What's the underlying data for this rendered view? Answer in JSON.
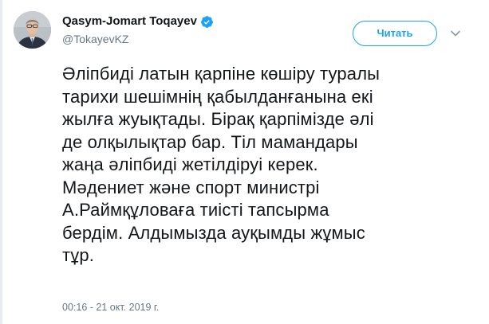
{
  "author": {
    "name": "Qasym-Jomart Toqayev",
    "handle": "@TokayevKZ",
    "verified": true
  },
  "actions": {
    "follow_label": "Читать"
  },
  "tweet": {
    "text": "Әліпбиді латын қарпіне көшіру туралы\nтарихи шешімнің қабылданғанына екі\nжылға жуықтады. Бірақ қарпімізде әлі\nде олқылықтар бар. Тіл мамандары\nжаңа әліпбиді жетілдіруі керек.\nМәдениет және спорт министрі\nА.Раймқұловаға тиісті тапсырма\nбердім. Алдымызда ауқымды жұмыс\nтұр.",
    "timestamp": "00:16 - 21 окт. 2019 г."
  },
  "colors": {
    "accent": "#1da1f2",
    "text": "#14171a",
    "muted": "#657786"
  }
}
